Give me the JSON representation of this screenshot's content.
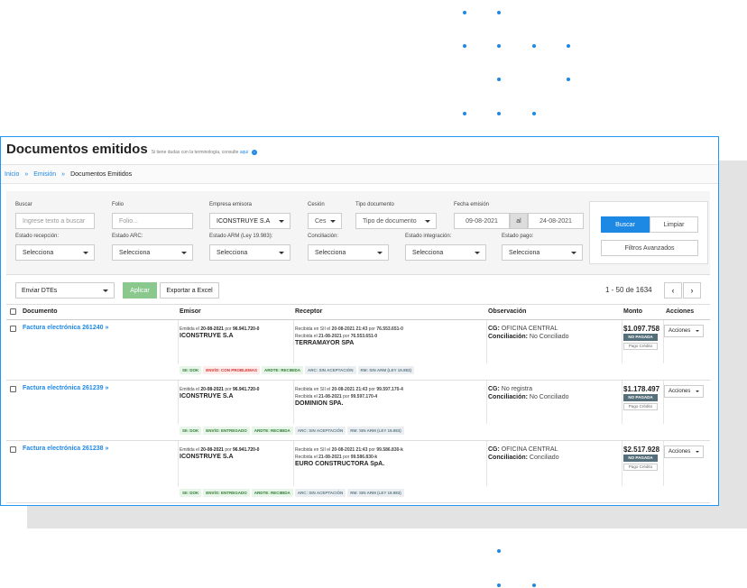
{
  "page": {
    "title": "Documentos emitidos",
    "help_text": "Si tiene dudas con la terminología, consulte",
    "help_link": "aquí",
    "info_icon": "i"
  },
  "breadcrumb": {
    "home": "Inicio",
    "sep": "»",
    "section": "Emisión",
    "current": "Documentos Emitidos"
  },
  "filters": {
    "buscar": {
      "label": "Buscar",
      "placeholder": "Ingrese texto a buscar"
    },
    "folio": {
      "label": "Folio",
      "placeholder": "Folio..."
    },
    "empresa": {
      "label": "Empresa emisora",
      "value": "ICONSTRUYE S.A"
    },
    "cesion": {
      "label": "Cesión",
      "value": "Ces"
    },
    "tipo": {
      "label": "Tipo documento",
      "value": "Tipo de documento"
    },
    "fecha": {
      "label": "Fecha emisión",
      "from": "09-08-2021",
      "sep": "al",
      "to": "24-08-2021"
    },
    "recepcion": {
      "label": "Estado recepción:",
      "value": "Selecciona"
    },
    "arc": {
      "label": "Estado ARC:",
      "value": "Selecciona"
    },
    "arm": {
      "label": "Estado ARM (Ley 19.983):",
      "value": "Selecciona"
    },
    "conciliacion": {
      "label": "Conciliación:",
      "value": "Selecciona"
    },
    "integracion": {
      "label": "Estado integración:",
      "value": "Selecciona"
    },
    "pago": {
      "label": "Estado pago:",
      "value": "Selecciona"
    },
    "buscar_btn": "Buscar",
    "limpiar_btn": "Limpiar",
    "avanzados_btn": "Filtros Avanzados"
  },
  "toolbar": {
    "action": "Enviar DTEs",
    "apply": "Aplicar",
    "export": "Exportar a Excel",
    "pagination": "1 - 50 de 1634",
    "prev": "‹",
    "next": "›"
  },
  "columns": {
    "documento": "Documento",
    "emisor": "Emisor",
    "receptor": "Receptor",
    "observacion": "Observación",
    "monto": "Monto",
    "acciones": "Acciones"
  },
  "rows": [
    {
      "doc": "Factura electrónica 261240 »",
      "em_prefix": "Emitida el",
      "em_date": "20-08-2021",
      "em_por": "por",
      "em_rut": "96.941.720-0",
      "em_name": "ICONSTRUYE S.A",
      "rc1_prefix": "Recibida en SII el",
      "rc1_date": "20-08-2021 21:43",
      "rc1_por": "por",
      "rc1_rut": "76.553.651-0",
      "rc2_prefix": "Recibida el",
      "rc2_date": "21-08-2021",
      "rc2_por": "por",
      "rc2_rut": "76.553.651-0",
      "rc_name": "TERRAMAYOR SPA",
      "cg_label": "CG:",
      "cg": "OFICINA CENTRAL",
      "con_label": "Conciliación:",
      "con": "No Conciliado",
      "monto": "$1.097.758",
      "estado": "NO PAGADA",
      "pago": "Pago Crédito",
      "acciones": "Acciones",
      "badges": [
        {
          "text": "SII: DOK",
          "tone": "green"
        },
        {
          "text": "ENVÍO: CON PROBLEMAS",
          "tone": "red"
        },
        {
          "text": "ARDTE: RECIBIDA",
          "tone": "green"
        },
        {
          "text": "ARC: SIN ACEPTACIÓN",
          "tone": "gray"
        },
        {
          "text": "RM: SIN ARM (LEY 19.983)",
          "tone": "gray"
        }
      ]
    },
    {
      "doc": "Factura electrónica 261239 »",
      "em_prefix": "Emitida el",
      "em_date": "20-08-2021",
      "em_por": "por",
      "em_rut": "96.941.720-0",
      "em_name": "ICONSTRUYE S.A",
      "rc1_prefix": "Recibida en SII el",
      "rc1_date": "20-08-2021 21:43",
      "rc1_por": "por",
      "rc1_rut": "99.597.170-4",
      "rc2_prefix": "Recibida el",
      "rc2_date": "21-08-2021",
      "rc2_por": "por",
      "rc2_rut": "99.597.170-4",
      "rc_name": "DOMINION SPA.",
      "cg_label": "CG:",
      "cg": "No registra",
      "con_label": "Conciliación:",
      "con": "No Conciliado",
      "monto": "$1.178.497",
      "estado": "NO PAGADA",
      "pago": "Pago Crédito",
      "acciones": "Acciones",
      "badges": [
        {
          "text": "SII: DOK",
          "tone": "green"
        },
        {
          "text": "ENVÍO: ENTREGADO",
          "tone": "green"
        },
        {
          "text": "ARDTE: RECIBIDA",
          "tone": "green"
        },
        {
          "text": "ARC: SIN ACEPTACIÓN",
          "tone": "gray"
        },
        {
          "text": "RM: SIN ARM (LEY 19.983)",
          "tone": "gray"
        }
      ]
    },
    {
      "doc": "Factura electrónica 261238 »",
      "em_prefix": "Emitida el",
      "em_date": "20-08-2021",
      "em_por": "por",
      "em_rut": "96.941.720-0",
      "em_name": "ICONSTRUYE S.A",
      "rc1_prefix": "Recibida en SII el",
      "rc1_date": "20-08-2021 21:43",
      "rc1_por": "por",
      "rc1_rut": "99.586.830-k",
      "rc2_prefix": "Recibida el",
      "rc2_date": "21-08-2021",
      "rc2_por": "por",
      "rc2_rut": "99.586.830-k",
      "rc_name": "EURO CONSTRUCTORA SpA.",
      "cg_label": "CG:",
      "cg": "OFICINA CENTRAL",
      "con_label": "Conciliación:",
      "con": "Conciliado",
      "monto": "$2.517.928",
      "estado": "NO PAGADA",
      "pago": "Pago Crédito",
      "acciones": "Acciones",
      "badges": [
        {
          "text": "SII: DOK",
          "tone": "green"
        },
        {
          "text": "ENVÍO: ENTREGADO",
          "tone": "green"
        },
        {
          "text": "ARDTE: RECIBIDA",
          "tone": "green"
        },
        {
          "text": "ARC: SIN ACEPTACIÓN",
          "tone": "gray"
        },
        {
          "text": "RM: SIN ARM (LEY 19.983)",
          "tone": "gray"
        }
      ]
    }
  ],
  "colors": {
    "accent": "#1e88e5",
    "apply": "#8bc88e",
    "status_badge": "#546e7a"
  }
}
